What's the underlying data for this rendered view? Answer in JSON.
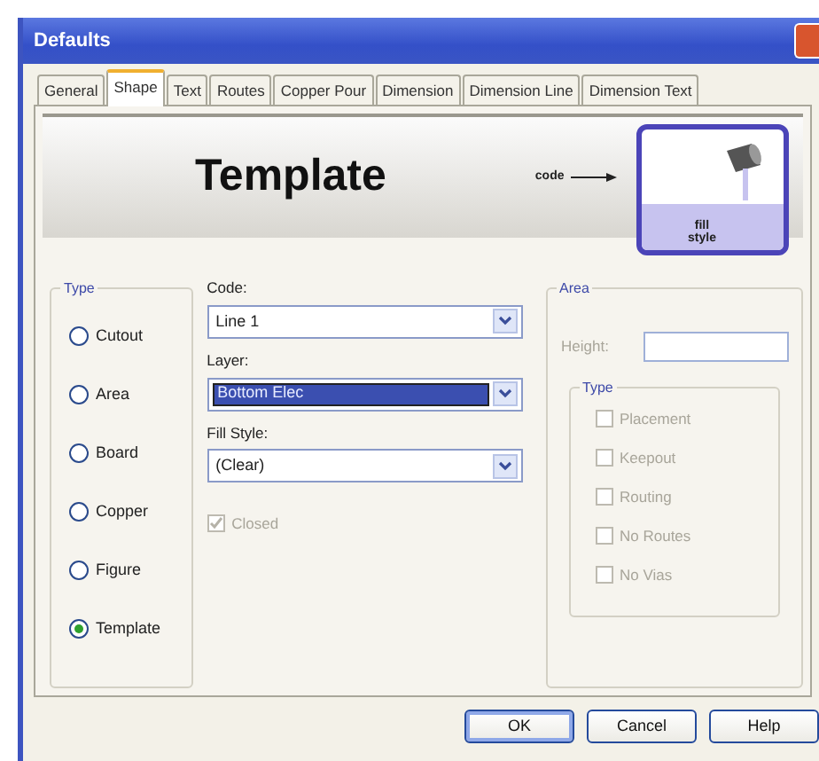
{
  "window": {
    "title": "Defaults"
  },
  "tabs": [
    {
      "label": "General",
      "selected": false
    },
    {
      "label": "Shape",
      "selected": true
    },
    {
      "label": "Text",
      "selected": false
    },
    {
      "label": "Routes",
      "selected": false
    },
    {
      "label": "Copper Pour",
      "selected": false
    },
    {
      "label": "Dimension",
      "selected": false
    },
    {
      "label": "Dimension Line",
      "selected": false
    },
    {
      "label": "Dimension Text",
      "selected": false
    }
  ],
  "banner": {
    "title": "Template",
    "code_label": "code",
    "fill_label": "fill style"
  },
  "type_group": {
    "legend": "Type",
    "options": [
      {
        "label": "Cutout",
        "selected": false
      },
      {
        "label": "Area",
        "selected": false
      },
      {
        "label": "Board",
        "selected": false
      },
      {
        "label": "Copper",
        "selected": false
      },
      {
        "label": "Figure",
        "selected": false
      },
      {
        "label": "Template",
        "selected": true
      }
    ]
  },
  "fields": [
    {
      "label": "Code:",
      "value": "Line 1",
      "highlighted": false
    },
    {
      "label": "Layer:",
      "value": "Bottom Elec",
      "highlighted": true
    },
    {
      "label": "Fill Style:",
      "value": "(Clear)",
      "highlighted": false
    }
  ],
  "closed": {
    "label": "Closed",
    "checked": true,
    "disabled": true
  },
  "area_group": {
    "legend": "Area",
    "disabled": true,
    "height": {
      "label": "Height:"
    },
    "type_legend": "Type",
    "options": [
      {
        "label": "Placement",
        "checked": false
      },
      {
        "label": "Keepout",
        "checked": false
      },
      {
        "label": "Routing",
        "checked": false
      },
      {
        "label": "No Routes",
        "checked": false
      },
      {
        "label": "No Vias",
        "checked": false
      }
    ]
  },
  "buttons": [
    {
      "label": "OK",
      "default": true
    },
    {
      "label": "Cancel",
      "default": false
    },
    {
      "label": "Help",
      "default": false
    }
  ]
}
